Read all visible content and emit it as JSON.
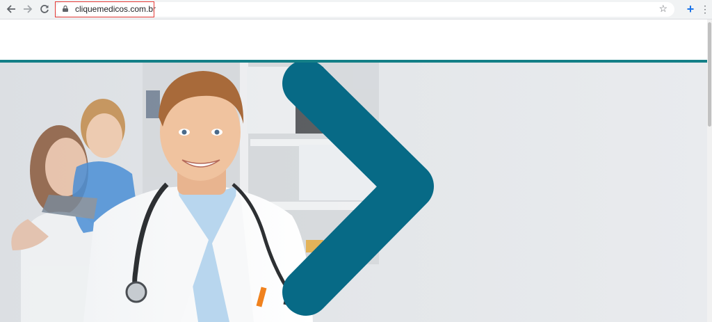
{
  "browser": {
    "url": "cliquemedicos.com.br",
    "back_icon": "back-arrow-icon",
    "forward_icon": "forward-arrow-icon",
    "reload_icon": "reload-icon",
    "lock_icon": "lock-icon",
    "star_icon": "star-icon",
    "extension_icon": "plus-icon",
    "menu_icon": "more-vert-icon"
  },
  "colors": {
    "brand_teal": "#137f87",
    "chevron_blue": "#076a86",
    "hero_background": "#e7e9ec"
  },
  "hero": {
    "image": "smiling doctor with stethoscope, mother and child in background",
    "chevron": "right-chevron-shape"
  }
}
